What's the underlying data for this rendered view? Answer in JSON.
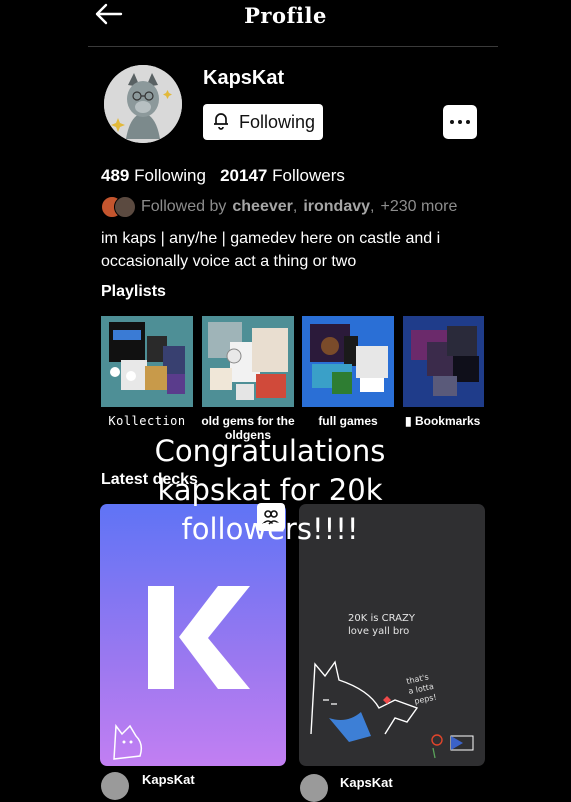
{
  "header": {
    "title": "Profile",
    "back_icon": "arrow-left-icon"
  },
  "profile": {
    "username": "KapsKat",
    "follow_button": "Following",
    "following_count": "489",
    "following_label": "Following",
    "followers_count": "20147",
    "followers_label": "Followers",
    "followed_by_prefix": "Followed by",
    "followed_by_users": [
      "cheever",
      "irondavy"
    ],
    "followed_by_more": "+230 more",
    "bio_line1": "im kaps | any/he | gamedev here on castle and i",
    "bio_line2": "occasionally voice act a thing or two"
  },
  "playlists": {
    "title": "Playlists",
    "items": [
      {
        "label": "Kollection"
      },
      {
        "label": "old gems for the oldgens"
      },
      {
        "label": "full games"
      },
      {
        "label": "Bookmarks"
      }
    ]
  },
  "overlay_text": {
    "line1": "Congratulations",
    "line2": "kapskat for 20k",
    "line3": "followers!!!!"
  },
  "latest_decks": {
    "title": "Latest decks",
    "decks": [
      {
        "author": "KapsKat",
        "cover_letter": "K"
      },
      {
        "author": "KapsKat",
        "doodle_line1": "20K is CRAZY",
        "doodle_line2": "love yall bro"
      }
    ]
  },
  "colors": {
    "background": "#000000",
    "deck1_gradient_top": "#5f74f5",
    "deck1_gradient_bottom": "#c27ff2",
    "deck2_bg": "#2f2f31",
    "muted_text": "#8d8d8d"
  }
}
